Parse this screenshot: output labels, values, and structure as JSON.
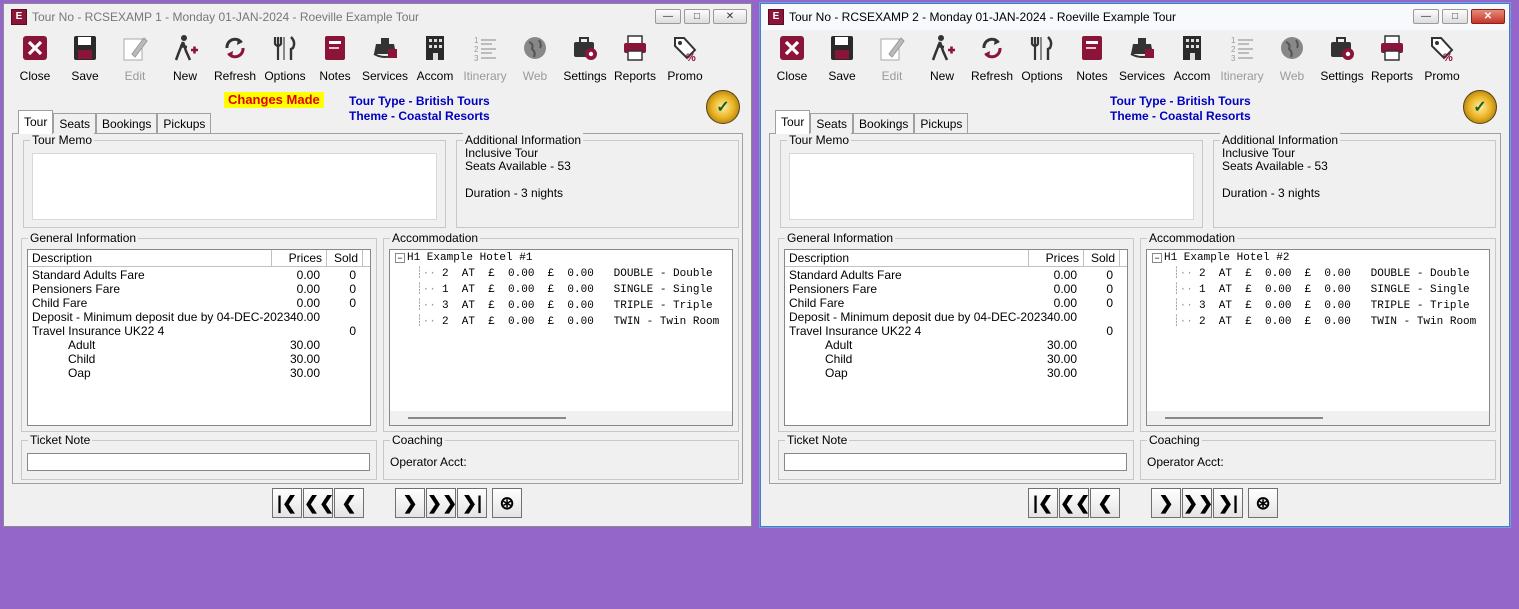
{
  "windows": [
    {
      "title": "Tour No - RCSEXAMP 1 - Monday 01-JAN-2024 - Roeville Example Tour",
      "changes_made": "Changes Made",
      "tour_type": "Tour Type - British Tours",
      "theme": "Theme - Coastal Resorts",
      "tabs": [
        "Tour",
        "Seats",
        "Bookings",
        "Pickups"
      ],
      "hotel": "H1 Example Hotel #1"
    },
    {
      "title": "Tour No - RCSEXAMP 2 - Monday 01-JAN-2024 - Roeville Example Tour",
      "changes_made": "",
      "tour_type": "Tour Type - British Tours",
      "theme": "Theme - Coastal Resorts",
      "tabs": [
        "Tour",
        "Seats",
        "Bookings",
        "Pickups"
      ],
      "hotel": "H1 Example Hotel #2"
    }
  ],
  "toolbar": [
    {
      "label": "Close",
      "icon": "close-icon",
      "enabled": true
    },
    {
      "label": "Save",
      "icon": "save-icon",
      "enabled": true
    },
    {
      "label": "Edit",
      "icon": "edit-icon",
      "enabled": false
    },
    {
      "label": "New",
      "icon": "new-icon",
      "enabled": true
    },
    {
      "label": "Refresh",
      "icon": "refresh-icon",
      "enabled": true
    },
    {
      "label": "Options",
      "icon": "options-icon",
      "enabled": true
    },
    {
      "label": "Notes",
      "icon": "notes-icon",
      "enabled": true
    },
    {
      "label": "Services",
      "icon": "services-icon",
      "enabled": true
    },
    {
      "label": "Accom",
      "icon": "accom-icon",
      "enabled": true
    },
    {
      "label": "Itinerary",
      "icon": "itinerary-icon",
      "enabled": false
    },
    {
      "label": "Web",
      "icon": "web-icon",
      "enabled": false
    },
    {
      "label": "Settings",
      "icon": "settings-icon",
      "enabled": true
    },
    {
      "label": "Reports",
      "icon": "reports-icon",
      "enabled": true
    },
    {
      "label": "Promo",
      "icon": "promo-icon",
      "enabled": true
    }
  ],
  "labels": {
    "tour_memo": "Tour Memo",
    "additional_information": "Additional Information",
    "general_information": "General Information",
    "accommodation": "Accommodation",
    "ticket_note": "Ticket Note",
    "coaching": "Coaching",
    "operator_acct": "Operator Acct:"
  },
  "additional_info": [
    "Inclusive Tour",
    "Seats Available - 53",
    "",
    "Duration - 3 nights"
  ],
  "general_columns": [
    "Description",
    "Prices",
    "Sold"
  ],
  "general_rows": [
    {
      "description": "Standard Adults Fare",
      "price": "0.00",
      "sold": "0",
      "indent": false
    },
    {
      "description": "Pensioners Fare",
      "price": "0.00",
      "sold": "0",
      "indent": false
    },
    {
      "description": "Child Fare",
      "price": "0.00",
      "sold": "0",
      "indent": false
    },
    {
      "description": "Deposit -  Minimum deposit due by 04-DEC-2023",
      "price": "40.00",
      "sold": "",
      "indent": false
    },
    {
      "description": "Travel Insurance  UK22  4",
      "price": "",
      "sold": "0",
      "indent": false
    },
    {
      "description": "Adult",
      "price": "30.00",
      "sold": "",
      "indent": true
    },
    {
      "description": "Child",
      "price": "30.00",
      "sold": "",
      "indent": true
    },
    {
      "description": "Oap",
      "price": "30.00",
      "sold": "",
      "indent": true
    }
  ],
  "accommodation_rows": [
    "2  AT  £  0.00  £  0.00   DOUBLE - Double",
    "1  AT  £  0.00  £  0.00   SINGLE - Single",
    "3  AT  £  0.00  £  0.00   TRIPLE - Triple",
    "2  AT  £  0.00  £  0.00   TWIN - Twin Room"
  ],
  "nav_buttons": [
    {
      "name": "first-record-button",
      "glyph": "|❮"
    },
    {
      "name": "previous-page-button",
      "glyph": "❮❮"
    },
    {
      "name": "previous-record-button",
      "glyph": "❮"
    },
    {
      "name": "next-record-button",
      "glyph": "❯"
    },
    {
      "name": "next-page-button",
      "glyph": "❯❯"
    },
    {
      "name": "last-record-button",
      "glyph": "❯|"
    },
    {
      "name": "search-button",
      "glyph": "⊛"
    }
  ],
  "colors": {
    "desktop": "#9466c9",
    "brand": "#8b1538",
    "tour_type_text": "#0000c0",
    "changes_made_bg": "#ffff00",
    "changes_made_text": "#e00000"
  }
}
